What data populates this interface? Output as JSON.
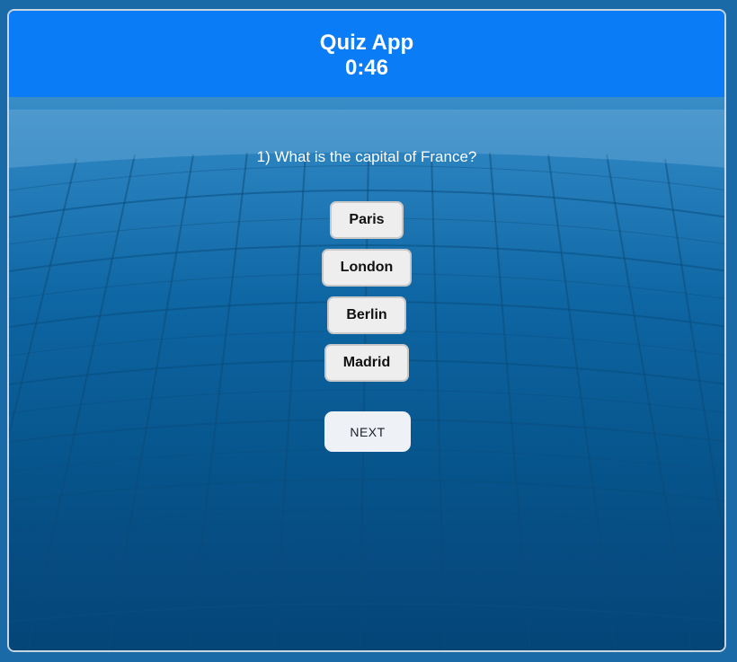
{
  "header": {
    "title": "Quiz App",
    "timer": "0:46"
  },
  "question": {
    "text": "1) What is the capital of France?"
  },
  "answers": [
    {
      "label": "Paris"
    },
    {
      "label": "London"
    },
    {
      "label": "Berlin"
    },
    {
      "label": "Madrid"
    }
  ],
  "next_label": "NEXT",
  "colors": {
    "header": "#0a7cf6",
    "button_bg": "#eeeeee"
  }
}
